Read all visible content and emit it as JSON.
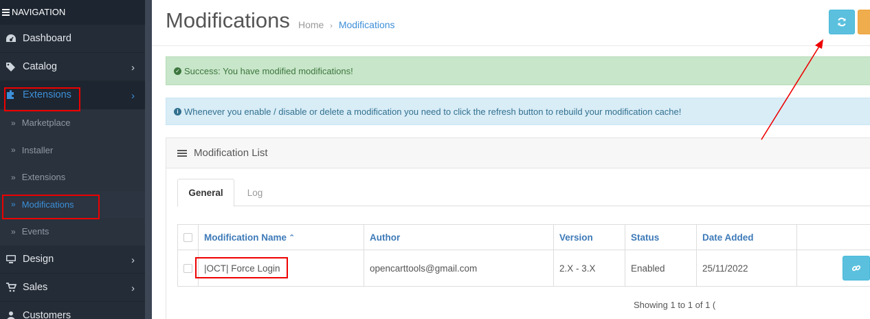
{
  "sidebar": {
    "title": "NAVIGATION",
    "items": [
      {
        "label": "Dashboard",
        "icon": "dashboard-icon"
      },
      {
        "label": "Catalog",
        "icon": "tags-icon"
      },
      {
        "label": "Extensions",
        "icon": "puzzle-icon"
      }
    ],
    "sub_items": [
      "Marketplace",
      "Installer",
      "Extensions",
      "Modifications",
      "Events"
    ],
    "items_after": [
      {
        "label": "Design",
        "icon": "desktop-icon"
      },
      {
        "label": "Sales",
        "icon": "cart-icon"
      },
      {
        "label": "Customers",
        "icon": "user-icon"
      }
    ]
  },
  "header": {
    "title": "Modifications",
    "breadcrumb": {
      "home": "Home",
      "current": "Modifications"
    },
    "buttons": {
      "refresh_icon": "refresh-icon",
      "refresh_color": "#5bc0de",
      "clear_color": "#f0ad4e"
    }
  },
  "alerts": {
    "success": "Success: You have modified modifications!",
    "info": "Whenever you enable / disable or delete a modification you need to click the refresh button to rebuild your modification cache!"
  },
  "panel": {
    "title": "Modification List",
    "tabs": [
      "General",
      "Log"
    ],
    "columns": [
      "Modification Name",
      "Author",
      "Version",
      "Status",
      "Date Added"
    ],
    "sort_indicator": "⌃",
    "rows": [
      {
        "name": "|OCT| Force Login",
        "author": "opencarttools@gmail.com",
        "version": "2.X - 3.X",
        "status": "Enabled",
        "date": "25/11/2022"
      }
    ],
    "showing": "Showing 1 to 1 of 1 ("
  },
  "colors": {
    "accent": "#3d8fd8",
    "annotation": "#e00000"
  }
}
